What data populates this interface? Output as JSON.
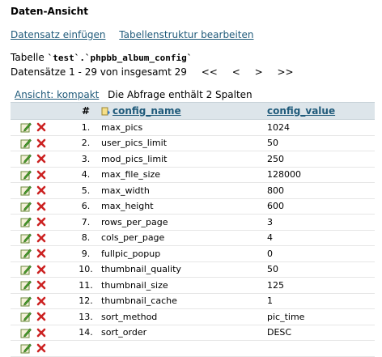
{
  "header": {
    "title": "Daten-Ansicht"
  },
  "actions": {
    "insert_label": "Datensatz einfügen",
    "edit_structure_label": "Tabellenstruktur bearbeiten"
  },
  "table_info": {
    "prefix": "Tabelle",
    "table_name": "`test`.`phpbb_album_config`"
  },
  "records": {
    "summary": "Datensätze 1 - 29 von insgesamt 29",
    "nav_first": "<<",
    "nav_prev": "<",
    "nav_next": ">",
    "nav_last": ">>"
  },
  "view": {
    "mode_label": "Ansicht: kompakt",
    "query_info": "Die Abfrage enthält 2 Spalten"
  },
  "columns": {
    "num": "#",
    "name": "config_name",
    "value": "config_value"
  },
  "rows": [
    {
      "num": "1.",
      "name": "max_pics",
      "value": "1024"
    },
    {
      "num": "2.",
      "name": "user_pics_limit",
      "value": "50"
    },
    {
      "num": "3.",
      "name": "mod_pics_limit",
      "value": "250"
    },
    {
      "num": "4.",
      "name": "max_file_size",
      "value": "128000"
    },
    {
      "num": "5.",
      "name": "max_width",
      "value": "800"
    },
    {
      "num": "6.",
      "name": "max_height",
      "value": "600"
    },
    {
      "num": "7.",
      "name": "rows_per_page",
      "value": "3"
    },
    {
      "num": "8.",
      "name": "cols_per_page",
      "value": "4"
    },
    {
      "num": "9.",
      "name": "fullpic_popup",
      "value": "0"
    },
    {
      "num": "10.",
      "name": "thumbnail_quality",
      "value": "50"
    },
    {
      "num": "11.",
      "name": "thumbnail_size",
      "value": "125"
    },
    {
      "num": "12.",
      "name": "thumbnail_cache",
      "value": "1"
    },
    {
      "num": "13.",
      "name": "sort_method",
      "value": "pic_time"
    },
    {
      "num": "14.",
      "name": "sort_order",
      "value": "DESC"
    },
    {
      "num": "",
      "name": "",
      "value": ""
    }
  ],
  "icons": {
    "edit": "pencil-edit-icon",
    "delete": "red-x-delete-icon",
    "sort": "sort-icon"
  },
  "colors": {
    "link": "#1f5a7a",
    "header_bg": "#dde5ea",
    "delete": "#cc2222",
    "edit": "#3a9a2a"
  }
}
